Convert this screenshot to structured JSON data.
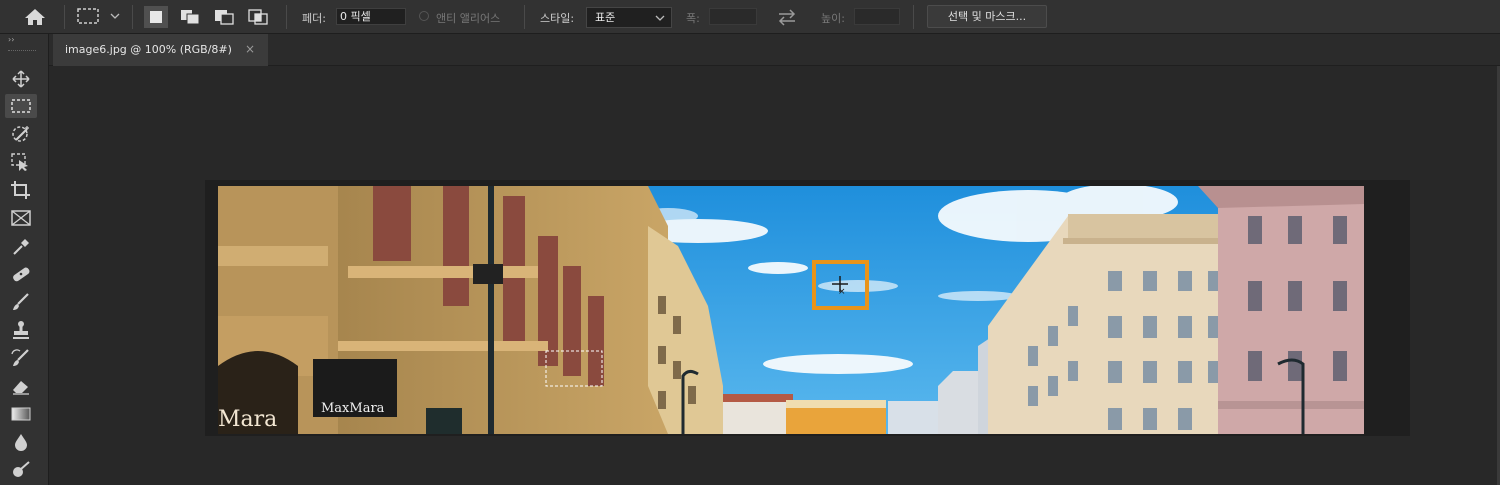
{
  "options_bar": {
    "feather_label": "페더:",
    "feather_value": "0 픽셀",
    "antialias_label": "앤티 앨리어스",
    "style_label": "스타일:",
    "style_value": "표준",
    "width_label": "폭:",
    "height_label": "높이:",
    "select_mask_label": "선택 및 마스크..."
  },
  "document_tab": {
    "title": "image6.jpg @ 100% (RGB/8#)",
    "close": "×"
  },
  "tools": [
    "move-tool",
    "rectangular-marquee-tool",
    "object-selection-tool",
    "quick-selection-tool",
    "crop-tool",
    "frame-tool",
    "eyedropper-tool",
    "spot-healing-tool",
    "brush-tool",
    "clone-stamp-tool",
    "history-brush-tool",
    "eraser-tool",
    "gradient-tool",
    "blur-tool",
    "dodge-tool"
  ],
  "image_text": {
    "shop_sign": "MaxMara",
    "shop_sign_partial": "Mara"
  },
  "colors": {
    "selection_highlight": "#e8941a",
    "sky": "#2a9ee4"
  }
}
